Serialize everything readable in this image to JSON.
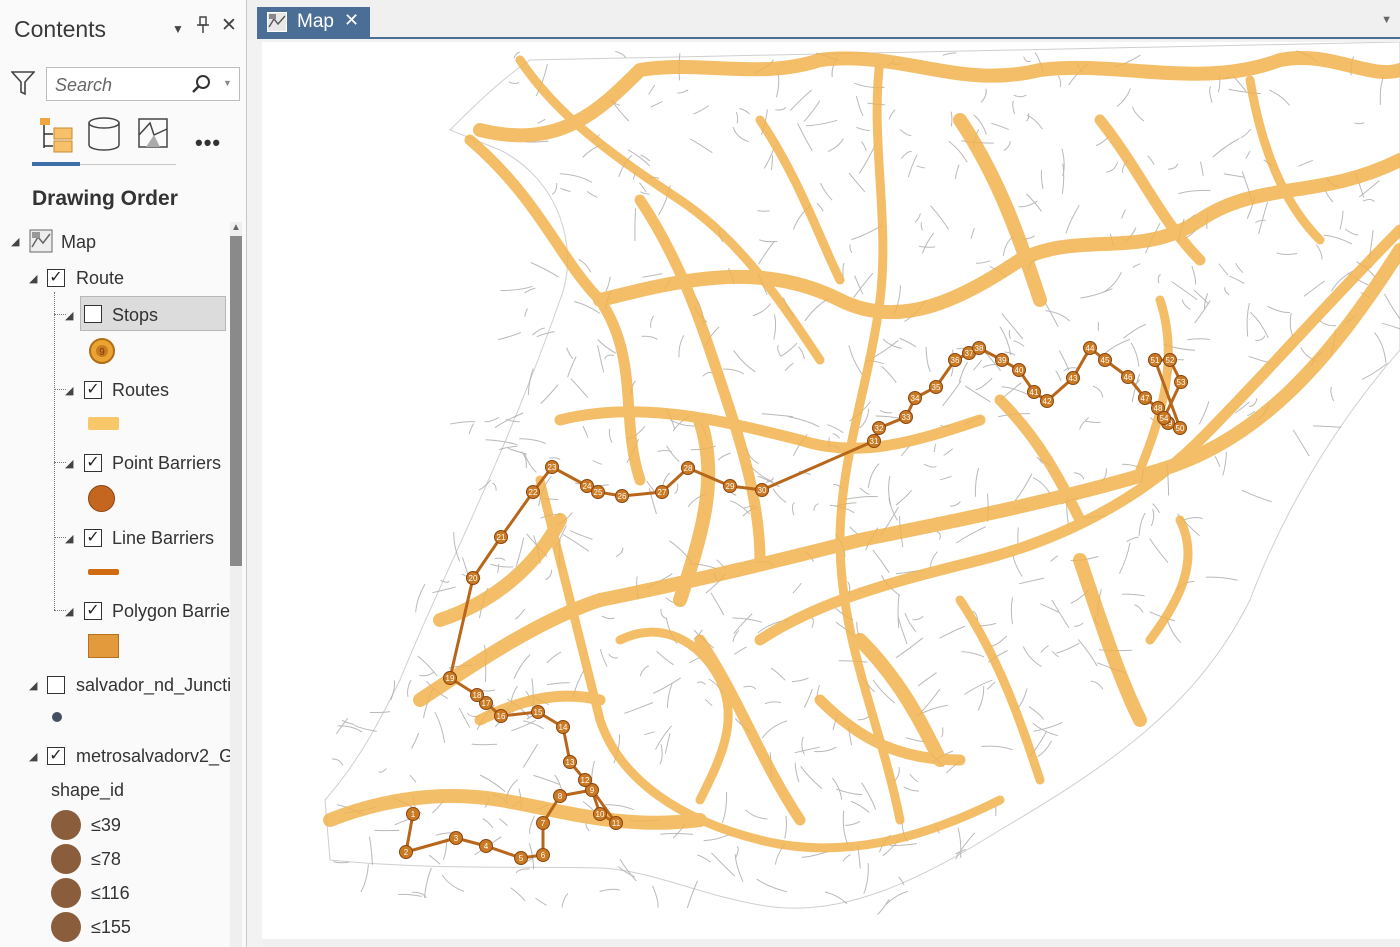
{
  "contents": {
    "title": "Contents",
    "search": {
      "placeholder": "Search"
    },
    "section_title": "Drawing Order",
    "tree": {
      "map": "Map",
      "route": "Route",
      "stops": "Stops",
      "stops_symbol_label": "9",
      "routes": "Routes",
      "point_barriers": "Point Barriers",
      "line_barriers": "Line Barriers",
      "polygon_barriers": "Polygon Barrie",
      "junctions": "salvador_nd_Juncti",
      "metro": "metrosalvadorv2_G",
      "field": "shape_id",
      "classes": [
        "≤39",
        "≤78",
        "≤116",
        "≤155"
      ]
    },
    "checked": {
      "route": true,
      "stops": false,
      "routes": true,
      "point_barriers": true,
      "line_barriers": true,
      "polygon_barriers": true,
      "junctions": false,
      "metro": true
    }
  },
  "map_view": {
    "tab_label": "Map",
    "route_stop_labels": [
      "1",
      "2",
      "3",
      "4",
      "5",
      "6",
      "7",
      "8",
      "9",
      "10",
      "11",
      "12",
      "13",
      "14",
      "15",
      "16",
      "17",
      "18",
      "19",
      "20",
      "21",
      "22",
      "23",
      "24",
      "25",
      "26",
      "27",
      "28",
      "29",
      "30",
      "31",
      "32",
      "33",
      "34",
      "35",
      "36",
      "37",
      "38",
      "39",
      "40",
      "41",
      "42",
      "43",
      "44",
      "45",
      "46",
      "47",
      "48",
      "49",
      "50",
      "51",
      "52",
      "53",
      "54",
      "55"
    ]
  },
  "colors": {
    "accent": "#4a6e96",
    "road_buffer": "#f1b34d",
    "route_line": "#b8661a",
    "stop_fill": "#c97a22",
    "class_fill": "#8a5e3c",
    "street": "#9a9a9a"
  }
}
